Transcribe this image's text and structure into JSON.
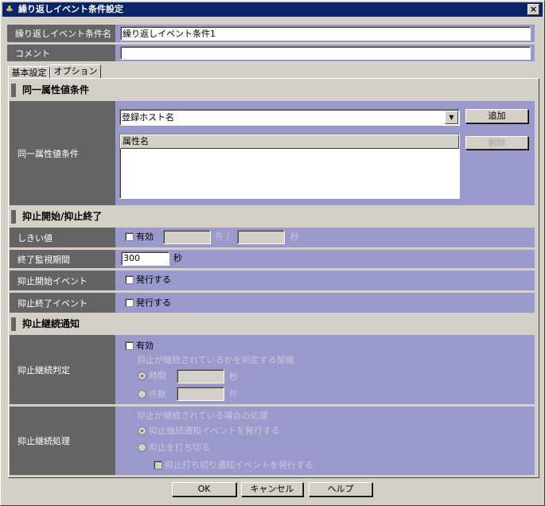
{
  "window": {
    "title": "繰り返しイベント条件設定",
    "close": "×"
  },
  "name": {
    "label": "繰り返しイベント条件名",
    "value": "繰り返しイベント条件1"
  },
  "comment": {
    "label": "コメント",
    "value": ""
  },
  "tabs": [
    {
      "label": "基本設定"
    },
    {
      "label": "オプション",
      "active": true
    }
  ],
  "same_attr": {
    "header": "同一属性値条件",
    "label": "同一属性値条件",
    "combo_value": "登録ホスト名",
    "add": "追加",
    "delete": "削除",
    "list_header": "属性名"
  },
  "suppress": {
    "header": "抑止開始/抑止終了",
    "threshold": {
      "label": "しきい値",
      "enable": "有効",
      "checked": false,
      "count_unit": "件 /",
      "sec_unit": "秒"
    },
    "end_period": {
      "label": "終了監視期間",
      "value": "300",
      "unit": "秒"
    },
    "start_event": {
      "label": "抑止開始イベント",
      "option": "発行する",
      "checked": false
    },
    "end_event": {
      "label": "抑止終了イベント",
      "option": "発行する",
      "checked": false
    }
  },
  "continue": {
    "header": "抑止継続通知",
    "judge": {
      "label": "抑止継続判定",
      "enable": "有効",
      "checked": false,
      "caption": "抑止が継続されているかを判定する契機",
      "time": "時間",
      "time_unit": "秒",
      "count": "件数",
      "count_unit": "件",
      "selected": "時間"
    },
    "process": {
      "label": "抑止継続処理",
      "caption": "抑止が継続されている場合の処理",
      "opt1": "抑止継続通知イベントを発行する",
      "opt2": "抑止を打ち切る",
      "sub": "抑止打ち切り通知イベントを発行する",
      "selected": "抑止継続通知イベントを発行する"
    }
  },
  "buttons": {
    "ok": "OK",
    "cancel": "キャンセル",
    "help": "ヘルプ"
  },
  "colors": {
    "titlebar": "#0a246a",
    "label_bg": "#646464",
    "field_bg": "#9999cc",
    "window": "#d4d0c8"
  }
}
